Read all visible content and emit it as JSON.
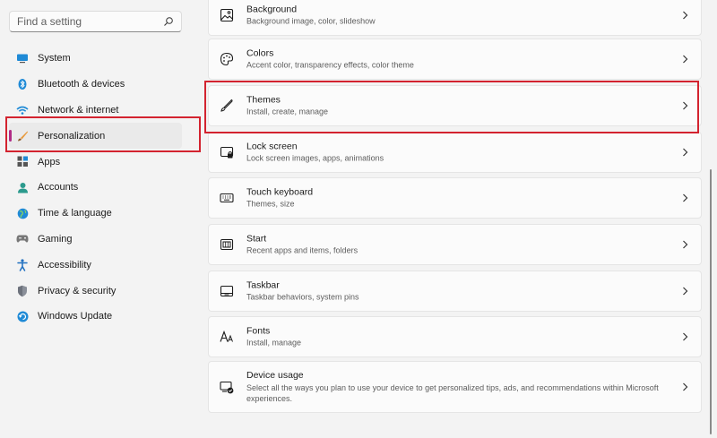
{
  "search": {
    "placeholder": "Find a setting"
  },
  "sidebar": {
    "items": [
      {
        "label": "System",
        "icon": "system-icon"
      },
      {
        "label": "Bluetooth & devices",
        "icon": "bluetooth-icon"
      },
      {
        "label": "Network & internet",
        "icon": "network-icon"
      },
      {
        "label": "Personalization",
        "icon": "personalization-icon",
        "active": true
      },
      {
        "label": "Apps",
        "icon": "apps-icon"
      },
      {
        "label": "Accounts",
        "icon": "accounts-icon"
      },
      {
        "label": "Time & language",
        "icon": "time-language-icon"
      },
      {
        "label": "Gaming",
        "icon": "gaming-icon"
      },
      {
        "label": "Accessibility",
        "icon": "accessibility-icon"
      },
      {
        "label": "Privacy & security",
        "icon": "privacy-icon"
      },
      {
        "label": "Windows Update",
        "icon": "windows-update-icon"
      }
    ]
  },
  "cards": [
    {
      "title": "Background",
      "subtitle": "Background image, color, slideshow",
      "icon": "background-icon"
    },
    {
      "title": "Colors",
      "subtitle": "Accent color, transparency effects, color theme",
      "icon": "palette-icon"
    },
    {
      "title": "Themes",
      "subtitle": "Install, create, manage",
      "icon": "brush-icon"
    },
    {
      "title": "Lock screen",
      "subtitle": "Lock screen images, apps, animations",
      "icon": "lock-screen-icon"
    },
    {
      "title": "Touch keyboard",
      "subtitle": "Themes, size",
      "icon": "keyboard-icon"
    },
    {
      "title": "Start",
      "subtitle": "Recent apps and items, folders",
      "icon": "start-icon"
    },
    {
      "title": "Taskbar",
      "subtitle": "Taskbar behaviors, system pins",
      "icon": "taskbar-icon"
    },
    {
      "title": "Fonts",
      "subtitle": "Install, manage",
      "icon": "fonts-icon"
    },
    {
      "title": "Device usage",
      "subtitle": "Select all the ways you plan to use your device to get personalized tips, ads, and recommendations within Microsoft experiences.",
      "icon": "device-usage-icon"
    }
  ],
  "colors": {
    "accent": "#b02a86",
    "highlight": "#d3232f"
  }
}
